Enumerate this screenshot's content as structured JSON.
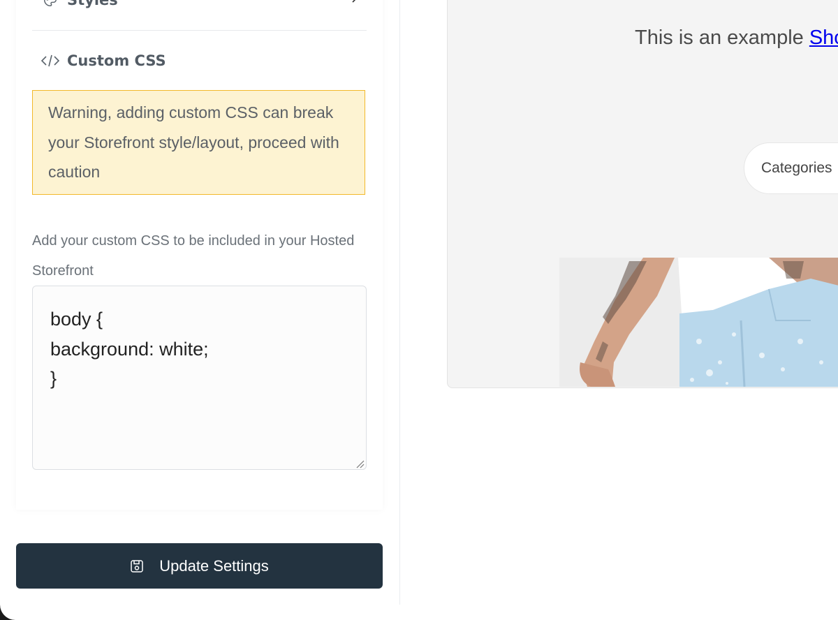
{
  "sections": {
    "styles_label": "Styles",
    "custom_css_label": "Custom CSS"
  },
  "warning": {
    "text": "Warning, adding custom CSS can break your Storefront style/layout, proceed with caution"
  },
  "help_text": "Add your custom CSS to be included in your Hosted Storefront",
  "css_editor": {
    "value": "body {\nbackground: white;\n}"
  },
  "update_button": {
    "label": "Update Settings",
    "icon": "save-icon"
  },
  "preview": {
    "example_text": "This is an example ",
    "example_link": "Sho",
    "categories_label": "Categories",
    "product_image": "model-light-wash-jeans-photo"
  },
  "colors": {
    "warning_bg": "#fdf3d2",
    "warning_border": "#f2b92a",
    "button_bg": "#233340",
    "link": "#0000ee"
  }
}
